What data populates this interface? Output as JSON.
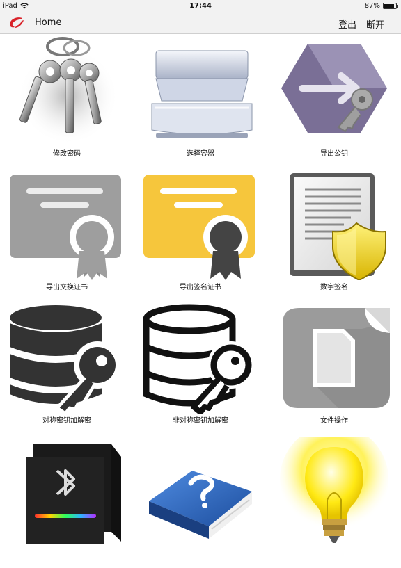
{
  "status": {
    "device": "iPad",
    "time": "17:44",
    "battery": "87%",
    "battery_level": 0.87
  },
  "nav": {
    "title": "Home",
    "logout": "登出",
    "disconnect": "断开"
  },
  "grid": {
    "items": [
      {
        "label": "修改密码",
        "icon": "keys-icon"
      },
      {
        "label": "选择容器",
        "icon": "container-drawer-icon"
      },
      {
        "label": "导出公钥",
        "icon": "export-public-key-icon"
      },
      {
        "label": "导出交换证书",
        "icon": "grey-certificate-icon"
      },
      {
        "label": "导出签名证书",
        "icon": "yellow-certificate-icon"
      },
      {
        "label": "数字签名",
        "icon": "signed-document-shield-icon"
      },
      {
        "label": "对称密钥加解密",
        "icon": "database-key-filled-icon"
      },
      {
        "label": "非对称密钥加解密",
        "icon": "database-key-outline-icon"
      },
      {
        "label": "文件操作",
        "icon": "file-operations-icon"
      },
      {
        "label": "",
        "icon": "bluetooth-box-icon"
      },
      {
        "label": "",
        "icon": "help-book-icon"
      },
      {
        "label": "",
        "icon": "light-bulb-icon"
      }
    ]
  }
}
